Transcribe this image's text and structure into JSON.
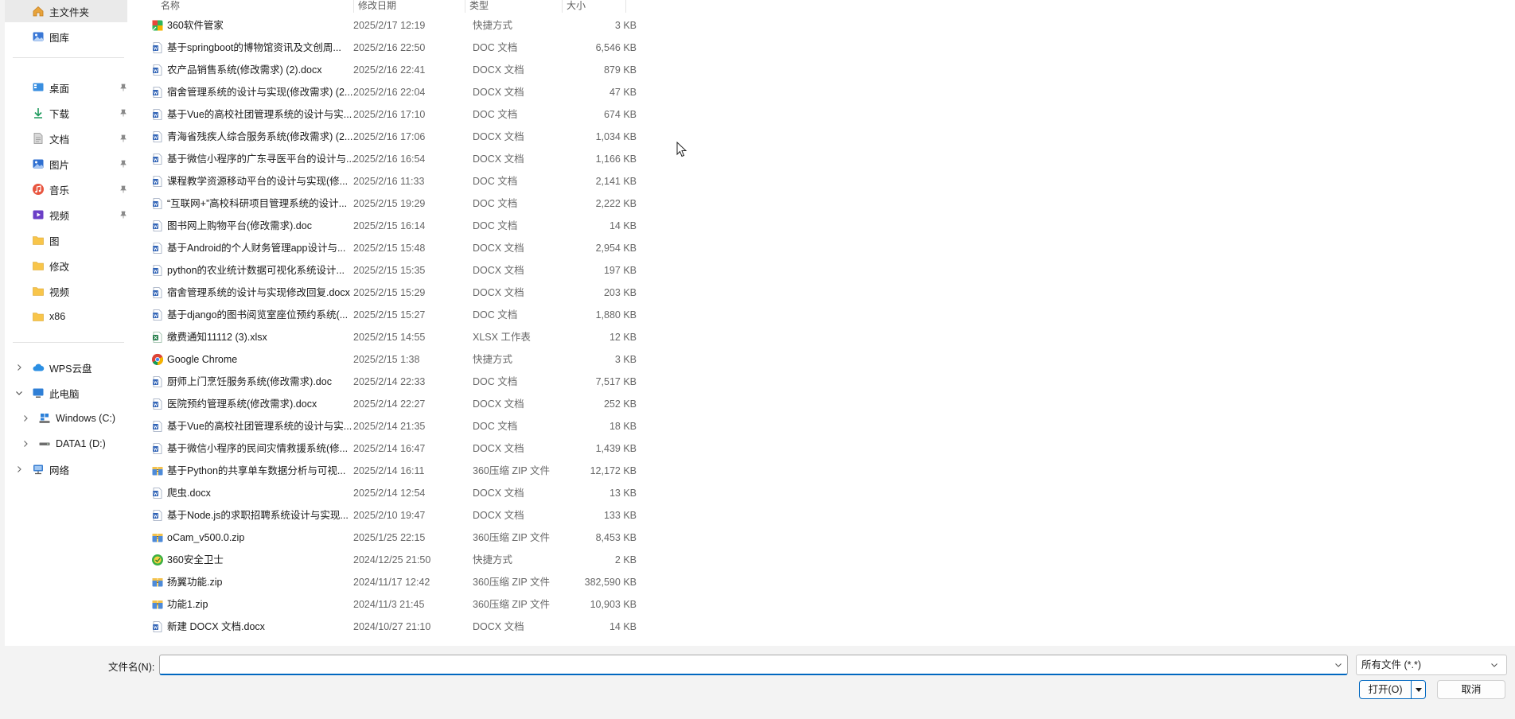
{
  "sidebar": {
    "home": "主文件夹",
    "gallery": "图库",
    "quick": [
      {
        "label": "桌面",
        "icon": "desktop-icon"
      },
      {
        "label": "下载",
        "icon": "download-icon"
      },
      {
        "label": "文档",
        "icon": "document-icon"
      },
      {
        "label": "图片",
        "icon": "pictures-icon"
      },
      {
        "label": "音乐",
        "icon": "music-icon"
      },
      {
        "label": "视频",
        "icon": "video-icon"
      }
    ],
    "folders": [
      "图",
      "修改",
      "视频",
      "x86"
    ],
    "tree": {
      "wps": "WPS云盘",
      "this_pc": "此电脑",
      "drive_c": "Windows (C:)",
      "drive_d": "DATA1 (D:)",
      "network": "网络"
    }
  },
  "columns": {
    "name": "名称",
    "date": "修改日期",
    "type": "类型",
    "size": "大小"
  },
  "files": [
    {
      "name": "360软件管家",
      "date": "2025/2/17 12:19",
      "type": "快捷方式",
      "size": "3 KB",
      "icon": "shortcut-360-icon"
    },
    {
      "name": "基于springboot的博物馆资讯及文创周...",
      "date": "2025/2/16 22:50",
      "type": "DOC 文档",
      "size": "6,546 KB",
      "icon": "word-doc-icon"
    },
    {
      "name": "农产品销售系统(修改需求) (2).docx",
      "date": "2025/2/16 22:41",
      "type": "DOCX 文档",
      "size": "879 KB",
      "icon": "word-doc-icon"
    },
    {
      "name": "宿舍管理系统的设计与实现(修改需求) (2...",
      "date": "2025/2/16 22:04",
      "type": "DOCX 文档",
      "size": "47 KB",
      "icon": "word-doc-icon"
    },
    {
      "name": "基于Vue的高校社团管理系统的设计与实...",
      "date": "2025/2/16 17:10",
      "type": "DOC 文档",
      "size": "674 KB",
      "icon": "word-doc-icon"
    },
    {
      "name": "青海省残疾人综合服务系统(修改需求) (2...",
      "date": "2025/2/16 17:06",
      "type": "DOCX 文档",
      "size": "1,034 KB",
      "icon": "word-doc-icon"
    },
    {
      "name": "基于微信小程序的广东寻医平台的设计与...",
      "date": "2025/2/16 16:54",
      "type": "DOCX 文档",
      "size": "1,166 KB",
      "icon": "word-doc-icon"
    },
    {
      "name": "课程教学资源移动平台的设计与实现(修...",
      "date": "2025/2/16 11:33",
      "type": "DOC 文档",
      "size": "2,141 KB",
      "icon": "word-doc-icon"
    },
    {
      "name": "“互联网+”高校科研项目管理系统的设计...",
      "date": "2025/2/15 19:29",
      "type": "DOC 文档",
      "size": "2,222 KB",
      "icon": "word-doc-icon"
    },
    {
      "name": "图书网上购物平台(修改需求).doc",
      "date": "2025/2/15 16:14",
      "type": "DOC 文档",
      "size": "14 KB",
      "icon": "word-doc-icon"
    },
    {
      "name": "基于Android的个人财务管理app设计与...",
      "date": "2025/2/15 15:48",
      "type": "DOCX 文档",
      "size": "2,954 KB",
      "icon": "word-doc-icon"
    },
    {
      "name": "python的农业统计数据可视化系统设计...",
      "date": "2025/2/15 15:35",
      "type": "DOCX 文档",
      "size": "197 KB",
      "icon": "word-doc-icon"
    },
    {
      "name": "宿舍管理系统的设计与实现修改回复.docx",
      "date": "2025/2/15 15:29",
      "type": "DOCX 文档",
      "size": "203 KB",
      "icon": "word-doc-icon"
    },
    {
      "name": "基于django的图书阅览室座位预约系统(...",
      "date": "2025/2/15 15:27",
      "type": "DOC 文档",
      "size": "1,880 KB",
      "icon": "word-doc-icon"
    },
    {
      "name": "缴费通知11112 (3).xlsx",
      "date": "2025/2/15 14:55",
      "type": "XLSX 工作表",
      "size": "12 KB",
      "icon": "excel-sheet-icon"
    },
    {
      "name": "Google Chrome",
      "date": "2025/2/15 1:38",
      "type": "快捷方式",
      "size": "3 KB",
      "icon": "chrome-icon"
    },
    {
      "name": "厨师上门烹饪服务系统(修改需求).doc",
      "date": "2025/2/14 22:33",
      "type": "DOC 文档",
      "size": "7,517 KB",
      "icon": "word-doc-icon"
    },
    {
      "name": "医院预约管理系统(修改需求).docx",
      "date": "2025/2/14 22:27",
      "type": "DOCX 文档",
      "size": "252 KB",
      "icon": "word-doc-icon"
    },
    {
      "name": "基于Vue的高校社团管理系统的设计与实...",
      "date": "2025/2/14 21:35",
      "type": "DOC 文档",
      "size": "18 KB",
      "icon": "word-doc-icon"
    },
    {
      "name": "基于微信小程序的民间灾情救援系统(修...",
      "date": "2025/2/14 16:47",
      "type": "DOCX 文档",
      "size": "1,439 KB",
      "icon": "word-doc-icon"
    },
    {
      "name": "基于Python的共享单车数据分析与可视...",
      "date": "2025/2/14 16:11",
      "type": "360压缩 ZIP 文件",
      "size": "12,172 KB",
      "icon": "zip-archive-icon"
    },
    {
      "name": "爬虫.docx",
      "date": "2025/2/14 12:54",
      "type": "DOCX 文档",
      "size": "13 KB",
      "icon": "word-doc-icon"
    },
    {
      "name": "基于Node.js的求职招聘系统设计与实现...",
      "date": "2025/2/10 19:47",
      "type": "DOCX 文档",
      "size": "133 KB",
      "icon": "word-doc-icon"
    },
    {
      "name": "oCam_v500.0.zip",
      "date": "2025/1/25 22:15",
      "type": "360压缩 ZIP 文件",
      "size": "8,453 KB",
      "icon": "zip-archive-icon"
    },
    {
      "name": "360安全卫士",
      "date": "2024/12/25 21:50",
      "type": "快捷方式",
      "size": "2 KB",
      "icon": "shortcut-360-safe-icon"
    },
    {
      "name": "扬翼功能.zip",
      "date": "2024/11/17 12:42",
      "type": "360压缩 ZIP 文件",
      "size": "382,590 KB",
      "icon": "zip-archive-icon"
    },
    {
      "name": "功能1.zip",
      "date": "2024/11/3 21:45",
      "type": "360压缩 ZIP 文件",
      "size": "10,903 KB",
      "icon": "zip-archive-icon"
    },
    {
      "name": "新建 DOCX 文档.docx",
      "date": "2024/10/27 21:10",
      "type": "DOCX 文档",
      "size": "14 KB",
      "icon": "word-doc-icon"
    }
  ],
  "footer": {
    "filename_label": "文件名(N):",
    "filename_value": "",
    "filetype": "所有文件 (*.*)",
    "open_label": "打开(O)",
    "cancel_label": "取消"
  },
  "colors": {
    "accent": "#0067c0",
    "folder": "#f8c54a",
    "word": "#2b5fb4",
    "excel": "#1f7a45"
  }
}
